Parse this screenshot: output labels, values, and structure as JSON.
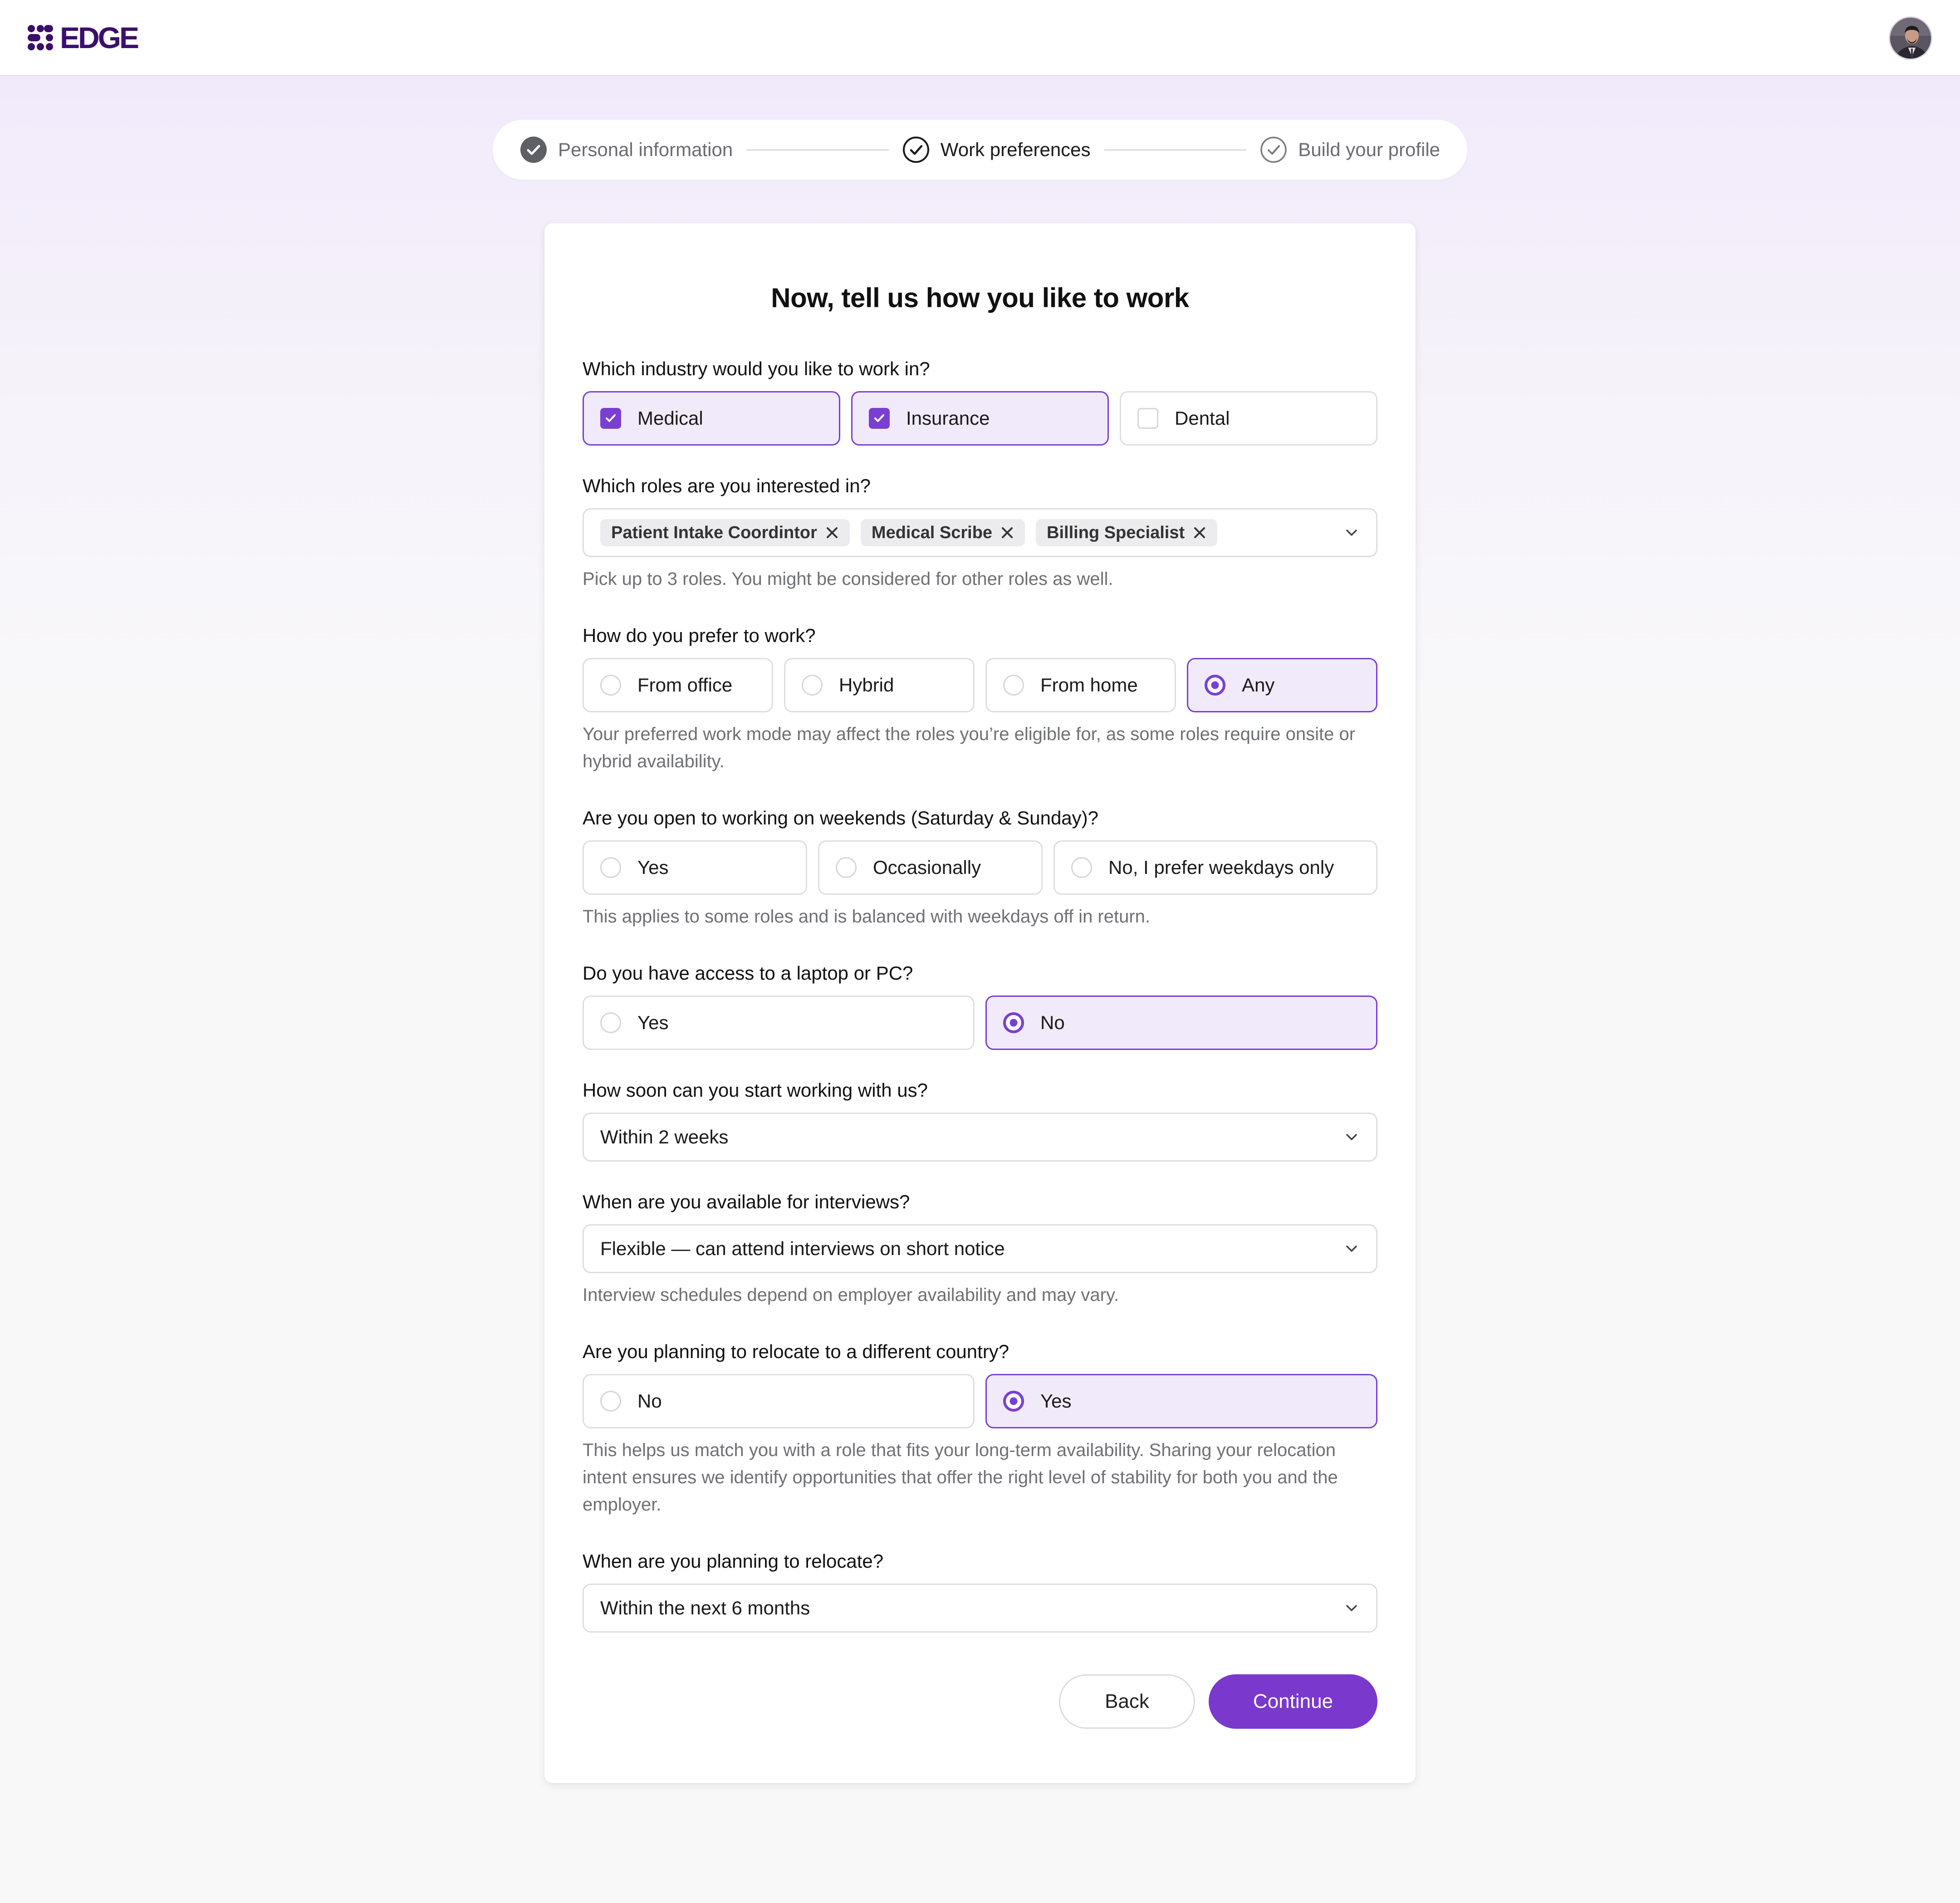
{
  "header": {
    "brand": "EDGE"
  },
  "stepper": {
    "steps": [
      {
        "label": "Personal information",
        "state": "done"
      },
      {
        "label": "Work preferences",
        "state": "current"
      },
      {
        "label": "Build your profile",
        "state": "upcoming"
      }
    ]
  },
  "form": {
    "title": "Now, tell us how you like to work",
    "industry": {
      "label": "Which industry would you like to work in?",
      "options": [
        {
          "label": "Medical",
          "checked": true
        },
        {
          "label": "Insurance",
          "checked": true
        },
        {
          "label": "Dental",
          "checked": false
        }
      ]
    },
    "roles": {
      "label": "Which roles are you interested in?",
      "chips": [
        "Patient Intake Coordintor",
        "Medical Scribe",
        "Billing Specialist"
      ],
      "hint": "Pick up to 3 roles. You might be considered for other roles as well."
    },
    "work_mode": {
      "label": "How do you prefer to work?",
      "options": [
        "From office",
        "Hybrid",
        "From home",
        "Any"
      ],
      "selected": "Any",
      "hint": "Your preferred work mode may affect the roles you’re eligible for, as some roles require onsite or hybrid availability."
    },
    "weekends": {
      "label": "Are you open to working on weekends (Saturday & Sunday)?",
      "options": [
        "Yes",
        "Occasionally",
        "No, I prefer weekdays only"
      ],
      "selected": null,
      "hint": "This applies to some roles and is balanced with weekdays off in return."
    },
    "laptop": {
      "label": "Do you have access to a laptop or PC?",
      "options": [
        "Yes",
        "No"
      ],
      "selected": "No"
    },
    "start": {
      "label": "How soon can you start working with us?",
      "value": "Within 2 weeks"
    },
    "interviews": {
      "label": "When are you available for interviews?",
      "value": "Flexible — can attend interviews on short notice",
      "hint": "Interview schedules depend on employer availability and may vary."
    },
    "relocate": {
      "label": "Are you planning to relocate to a different country?",
      "options": [
        "No",
        "Yes"
      ],
      "selected": "Yes",
      "hint": "This helps us match you with a role that fits your long-term availability. Sharing your relocation intent ensures we identify opportunities that offer the right level of stability for both you and the employer."
    },
    "relocate_when": {
      "label": "When are you planning to relocate?",
      "value": "Within the next 6 months"
    },
    "actions": {
      "back": "Back",
      "continue": "Continue"
    }
  },
  "colors": {
    "accent": "#7a38cc",
    "brand": "#3b0f6b",
    "selected_bg": "#f1eafa"
  }
}
